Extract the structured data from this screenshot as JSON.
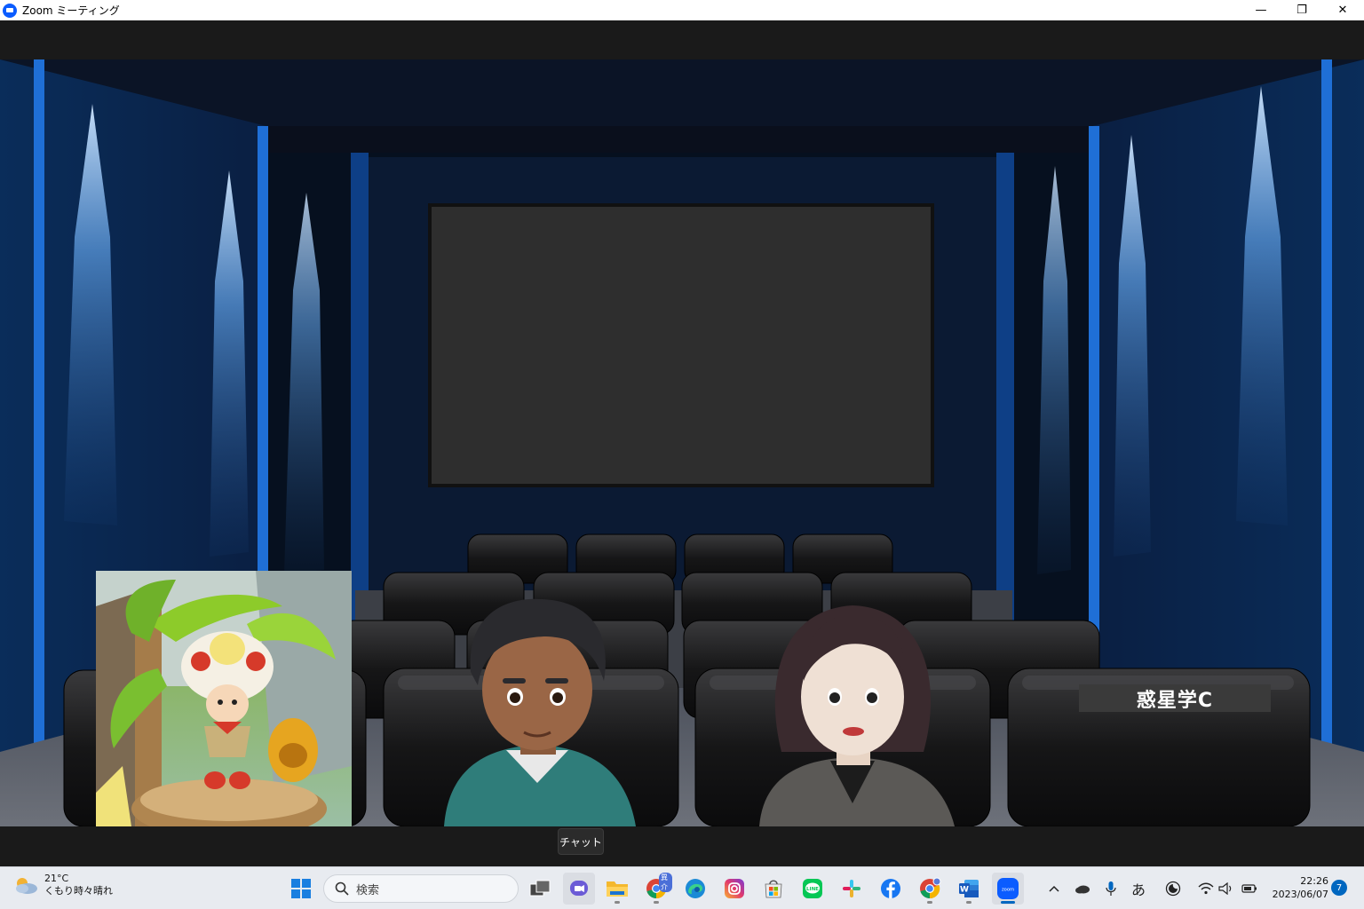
{
  "window": {
    "title": "Zoom ミーティング",
    "minimize_glyph": "—",
    "restore_glyph": "❐",
    "close_glyph": "✕"
  },
  "meeting": {
    "participant_name_label": "惑星学C",
    "tooltip": "チャット"
  },
  "taskbar": {
    "weather_temp": "21°C",
    "weather_desc": "くもり時々晴れ",
    "search_placeholder": "検索",
    "chrome_badge": "異介",
    "ime_mode": "あ",
    "time": "22:26",
    "date": "2023/06/07",
    "notification_count": "7",
    "pinned_apps": [
      "start",
      "search",
      "task-view",
      "teams-chat",
      "file-explorer",
      "chrome",
      "edge",
      "instagram",
      "microsoft-store",
      "line",
      "slack",
      "facebook",
      "chrome-profile",
      "word",
      "zoom"
    ]
  },
  "colors": {
    "accent_blue": "#0b5cff",
    "stage_blue": "#1f6fd6",
    "taskbar_bg": "#e8ebf0"
  }
}
